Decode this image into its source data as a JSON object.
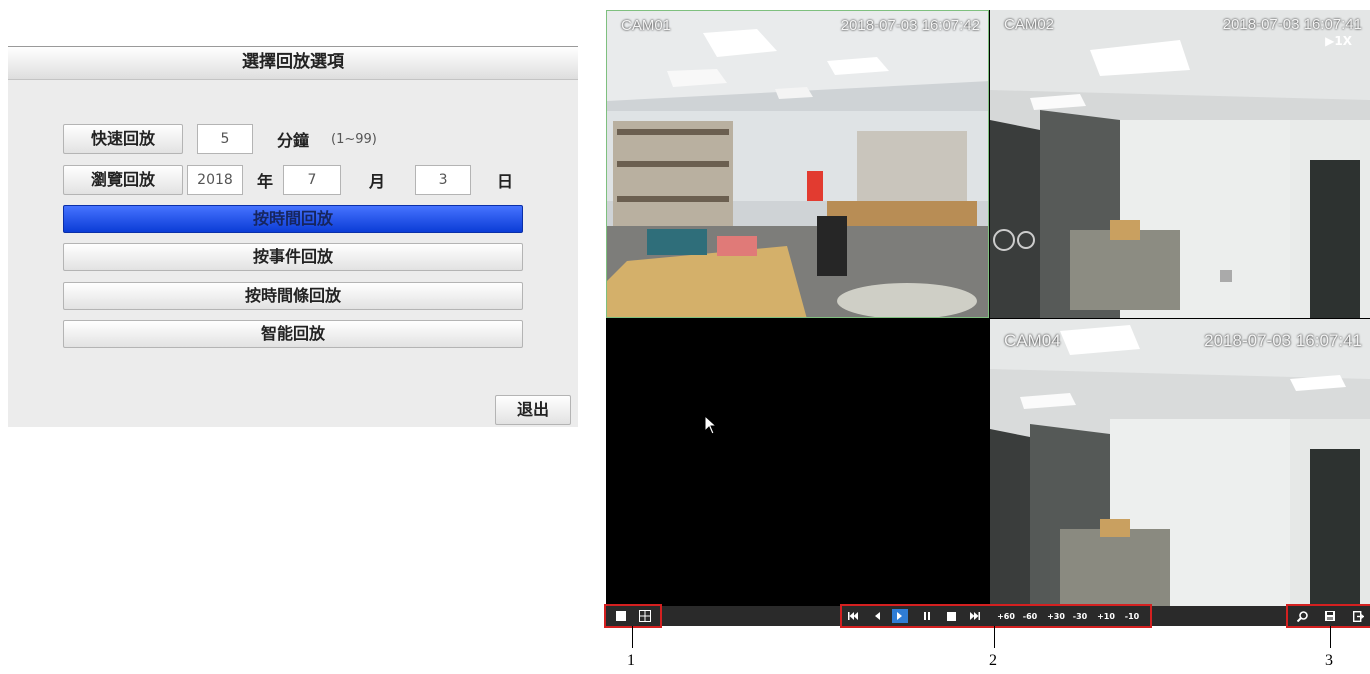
{
  "dialog": {
    "title": "選擇回放選項",
    "quick_playback": {
      "label": "快速回放",
      "value": "5",
      "unit": "分鐘",
      "range": "(1~99)"
    },
    "browse_playback": {
      "label": "瀏覽回放",
      "year": "2018",
      "year_unit": "年",
      "month": "7",
      "month_unit": "月",
      "day": "3",
      "day_unit": "日"
    },
    "options": [
      "按時間回放",
      "按事件回放",
      "按時間條回放",
      "智能回放"
    ],
    "selected_option": "按時間回放",
    "exit_label": "退出"
  },
  "cameras": [
    {
      "name": "CAM01",
      "time": "2018-07-03 16:07:42"
    },
    {
      "name": "CAM02",
      "time": "2018-07-03 16:07:41",
      "speed": "▶1X"
    },
    {
      "name": "",
      "time": ""
    },
    {
      "name": "CAM04",
      "time": "2018-07-03 16:07:41"
    }
  ],
  "controls": {
    "layout": [
      "single-view-icon",
      "quad-view-icon"
    ],
    "playback": [
      "fast-rewind-icon",
      "reverse-play-icon",
      "play-icon",
      "pause-icon",
      "stop-icon",
      "fast-forward-icon"
    ],
    "jumps": [
      "+60",
      "-60",
      "+30",
      "-30",
      "+10",
      "-10"
    ],
    "tools": [
      "zoom-icon",
      "save-icon",
      "exit-icon"
    ]
  },
  "callouts": [
    "1",
    "2",
    "3"
  ],
  "colors": {
    "selected_option": "#0b3cd6",
    "highlight_box": "#d42020",
    "play_active": "#2f7dd6",
    "active_tile_border": "#7fc07f"
  }
}
